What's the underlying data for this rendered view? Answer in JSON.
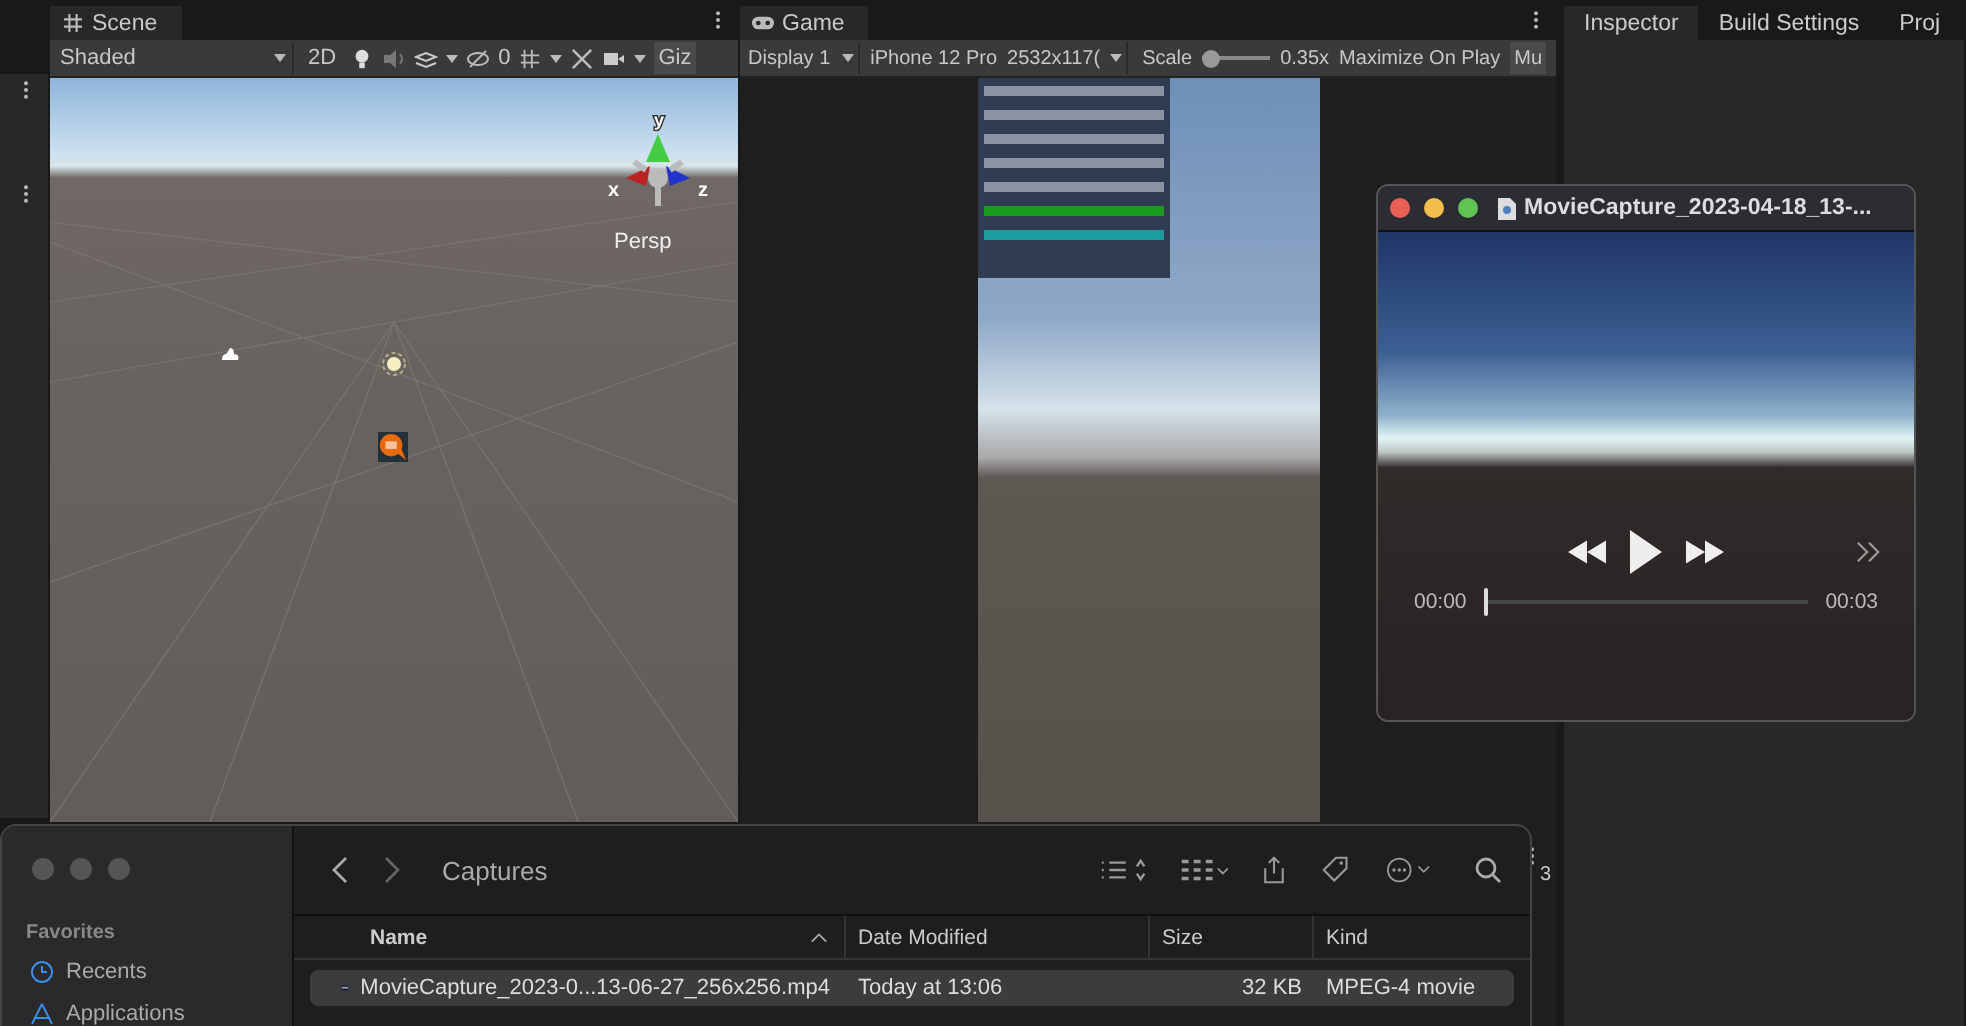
{
  "scene_view": {
    "tab": "Scene",
    "draw_mode": "Shaded",
    "mode_2d": "2D",
    "hidden_count": "0",
    "gizmos": "Giz",
    "axes": {
      "y": "y",
      "x": "x",
      "z": "z"
    },
    "projection": "Persp"
  },
  "game_view": {
    "tab": "Game",
    "display": "Display 1",
    "device": "iPhone 12 Pro",
    "resolution": "2532x117(",
    "scale_label": "Scale",
    "scale": {
      "level": 0
    },
    "scale_value": "0.35x",
    "maximize": "Maximize On Play",
    "mute": "Mu",
    "side_label": "3"
  },
  "inspector": {
    "tabs": [
      {
        "label": "Inspector",
        "selected": true
      },
      {
        "label": "Build Settings",
        "selected": false
      },
      {
        "label": "Proj",
        "selected": false
      }
    ]
  },
  "player": {
    "title": "MovieCapture_2023-04-18_13-...",
    "current": "00:00",
    "duration": "00:03",
    "progress": {
      "level": 0
    }
  },
  "finder": {
    "folder": "Captures",
    "sidebar": {
      "heading": "Favorites",
      "items": [
        {
          "label": "Recents",
          "selected": false
        },
        {
          "label": "Applications",
          "selected": false
        }
      ]
    },
    "columns": [
      "Name",
      "Date Modified",
      "Size",
      "Kind"
    ],
    "rows": [
      {
        "name": "MovieCapture_2023-0...13-06-27_256x256.mp4",
        "date": "Today at 13:06",
        "size": "32 KB",
        "kind": "MPEG-4 movie",
        "selected": true
      }
    ]
  }
}
